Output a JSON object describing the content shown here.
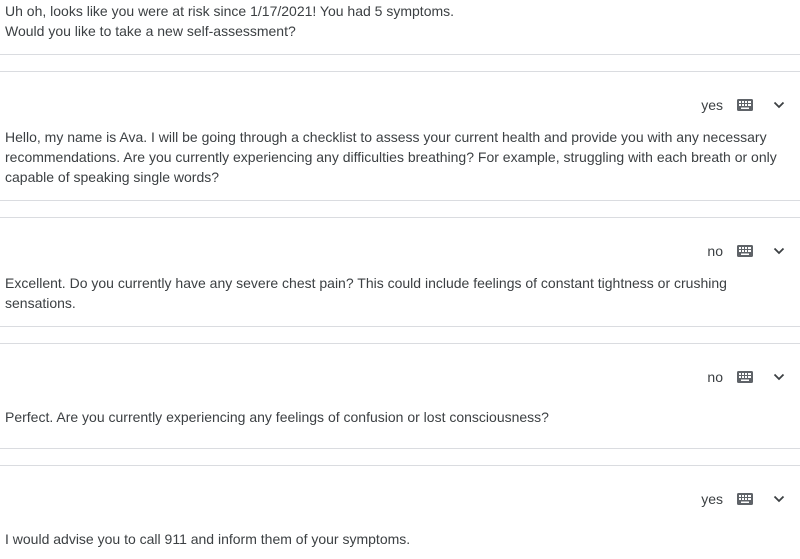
{
  "intro": {
    "line1": "Uh oh, looks like you were at risk since 1/17/2021! You had 5 symptoms.",
    "line2": "Would you like to take a new self-assessment?"
  },
  "turns": [
    {
      "user_input": "yes",
      "response": "Hello, my name is Ava. I will be going through a checklist to assess your current health and provide you with any necessary recommendations. Are you currently experiencing any difficulties breathing? For example, struggling with each breath or only capable of speaking single words?"
    },
    {
      "user_input": "no",
      "response": "Excellent. Do you currently have any severe chest pain? This could include feelings of constant tightness or crushing sensations."
    },
    {
      "user_input": "no",
      "response": "Perfect. Are you currently experiencing any feelings of confusion or lost consciousness?"
    },
    {
      "user_input": "yes",
      "response": "I would advise you to call 911 and inform them of your symptoms."
    }
  ],
  "icons": {
    "input_method": "keyboard-icon",
    "expand": "chevron-down-icon"
  },
  "colors": {
    "text": "#3c4043",
    "icon": "#5f6368",
    "divider": "#dadce0",
    "background": "#ffffff"
  }
}
